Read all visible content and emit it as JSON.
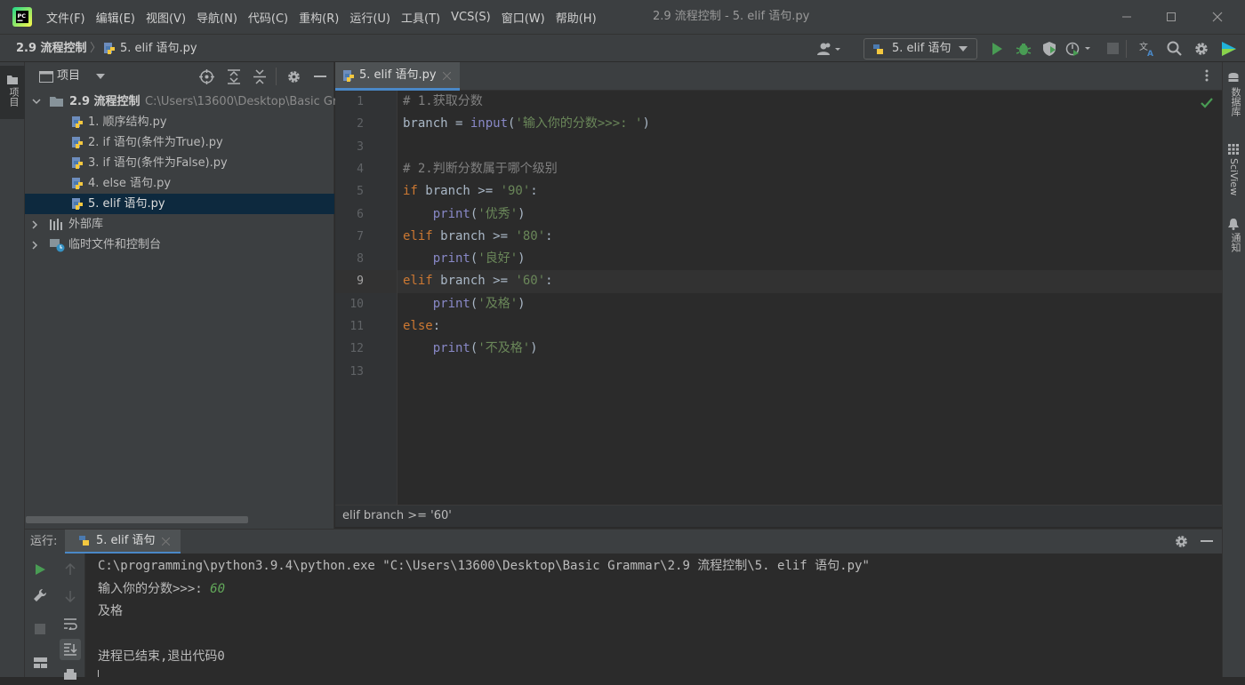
{
  "menu": [
    "文件(F)",
    "编辑(E)",
    "视图(V)",
    "导航(N)",
    "代码(C)",
    "重构(R)",
    "运行(U)",
    "工具(T)",
    "VCS(S)",
    "窗口(W)",
    "帮助(H)"
  ],
  "window_title": "2.9 流程控制 - 5. elif 语句.py",
  "nav": {
    "project": "2.9 流程控制",
    "file": "5. elif 语句.py",
    "run_config": "5. elif 语句"
  },
  "left_stripe": {
    "project_label": "项目"
  },
  "right_stripe": {
    "database": "数据库",
    "sciview": "SciView",
    "notifications": "通知"
  },
  "project_panel": {
    "title": "项目",
    "root": {
      "name": "2.9 流程控制",
      "path": "C:\\Users\\13600\\Desktop\\Basic Gr"
    },
    "files": [
      "1. 顺序结构.py",
      "2. if 语句(条件为True).py",
      "3. if 语句(条件为False).py",
      "4. else 语句.py",
      "5. elif 语句.py"
    ],
    "external": "外部库",
    "scratches": "临时文件和控制台"
  },
  "editor": {
    "tab": "5. elif 语句.py",
    "line_numbers": [
      "1",
      "2",
      "3",
      "4",
      "5",
      "6",
      "7",
      "8",
      "9",
      "10",
      "11",
      "12",
      "13"
    ],
    "breadcrumb": "elif branch >= '60'"
  },
  "code": {
    "l1": "# 1.获取分数",
    "l2_var": "branch = ",
    "l2_fn": "input",
    "l2_open": "(",
    "l2_str": "'输入你的分数>>>: '",
    "l2_close": ")",
    "l4": "# 2.判断分数属于哪个级别",
    "if_kw": "if",
    "l5_cond": " branch >= ",
    "l5_str": "'90'",
    "colon": ":",
    "indent": "    ",
    "print_fn": "print",
    "l6_str": "'优秀'",
    "elif_kw": "elif",
    "l7_cond": " branch >= ",
    "l7_str": "'80'",
    "l8_str": "'良好'",
    "l9_cond": " branch >= ",
    "l9_str": "'60'",
    "l10_str": "'及格'",
    "else_kw": "else",
    "l12_str": "'不及格'",
    "open_paren": "(",
    "close_paren": ")"
  },
  "run": {
    "label": "运行:",
    "tab": "5. elif 语句",
    "cmd": "C:\\programming\\python3.9.4\\python.exe \"C:\\Users\\13600\\Desktop\\Basic Grammar\\2.9 流程控制\\5. elif 语句.py\"",
    "prompt": "输入你的分数>>>: ",
    "input_value": "60",
    "output": "及格",
    "exit_message": "进程已结束,退出代码0"
  },
  "colors": {
    "accent_green": "#499c54",
    "selection": "#0d293e",
    "input_green": "#62a85a"
  }
}
